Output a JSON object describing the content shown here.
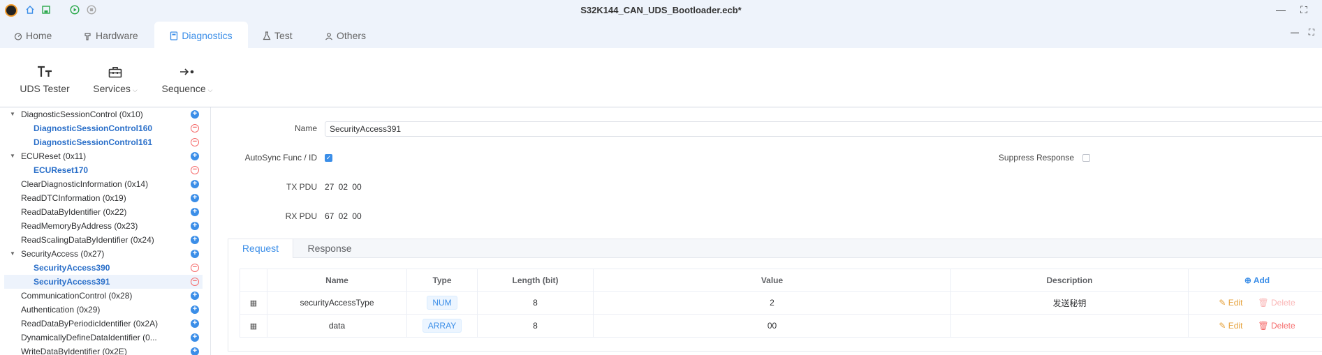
{
  "window": {
    "title": "S32K144_CAN_UDS_Bootloader.ecb*",
    "minimize": "—",
    "maximize": "⛶"
  },
  "menu_tabs": [
    {
      "label": "Home",
      "icon": "home-icon"
    },
    {
      "label": "Hardware",
      "icon": "hammer-icon"
    },
    {
      "label": "Diagnostics",
      "icon": "diagnostics-icon",
      "active": true
    },
    {
      "label": "Test",
      "icon": "flask-icon"
    },
    {
      "label": "Others",
      "icon": "person-icon"
    }
  ],
  "ribbon": {
    "uds_tester": "UDS Tester",
    "services": "Services",
    "sequence": "Sequence"
  },
  "tree": [
    {
      "label": "DiagnosticSessionControl (0x10)",
      "level": 0,
      "expanded": true,
      "btn": "add"
    },
    {
      "label": "DiagnosticSessionControl160",
      "level": 1,
      "btn": "remove"
    },
    {
      "label": "DiagnosticSessionControl161",
      "level": 1,
      "btn": "remove"
    },
    {
      "label": "ECUReset (0x11)",
      "level": 0,
      "expanded": true,
      "btn": "add"
    },
    {
      "label": "ECUReset170",
      "level": 1,
      "btn": "remove"
    },
    {
      "label": "ClearDiagnosticInformation (0x14)",
      "level": 0,
      "btn": "add"
    },
    {
      "label": "ReadDTCInformation (0x19)",
      "level": 0,
      "btn": "add"
    },
    {
      "label": "ReadDataByIdentifier (0x22)",
      "level": 0,
      "btn": "add"
    },
    {
      "label": "ReadMemoryByAddress (0x23)",
      "level": 0,
      "btn": "add"
    },
    {
      "label": "ReadScalingDataByIdentifier (0x24)",
      "level": 0,
      "btn": "add"
    },
    {
      "label": "SecurityAccess (0x27)",
      "level": 0,
      "expanded": true,
      "btn": "add"
    },
    {
      "label": "SecurityAccess390",
      "level": 1,
      "btn": "remove"
    },
    {
      "label": "SecurityAccess391",
      "level": 1,
      "btn": "remove",
      "selected": true
    },
    {
      "label": "CommunicationControl (0x28)",
      "level": 0,
      "btn": "add"
    },
    {
      "label": "Authentication (0x29)",
      "level": 0,
      "btn": "add"
    },
    {
      "label": "ReadDataByPeriodicIdentifier (0x2A)",
      "level": 0,
      "btn": "add"
    },
    {
      "label": "DynamicallyDefineDataIdentifier (0...",
      "level": 0,
      "btn": "add"
    },
    {
      "label": "WriteDataByIdentifier (0x2E)",
      "level": 0,
      "btn": "add"
    }
  ],
  "form": {
    "name_label": "Name",
    "name_value": "SecurityAccess391",
    "autosync_label": "AutoSync Func / ID",
    "autosync_checked": true,
    "suppress_label": "Suppress Response",
    "suppress_checked": false,
    "tx_label": "TX PDU",
    "tx_value": "27 02 00",
    "rx_label": "RX PDU",
    "rx_value": "67 02 00"
  },
  "panel": {
    "tabs": [
      "Request",
      "Response"
    ],
    "active_tab": "Request",
    "columns": [
      "Name",
      "Type",
      "Length (bit)",
      "Value",
      "Description"
    ],
    "add_label": "Add",
    "edit_label": "Edit",
    "delete_label": "Delete",
    "rows": [
      {
        "name": "securityAccessType",
        "type": "NUM",
        "length": "8",
        "value": "2",
        "description": "发送秘钥",
        "delete_disabled": true
      },
      {
        "name": "data",
        "type": "ARRAY",
        "length": "8",
        "value": "00",
        "description": "",
        "delete_disabled": false
      }
    ]
  },
  "colors": {
    "accent": "#3b8ee8",
    "danger": "#f56c6c",
    "warning": "#e6a23c",
    "chrome_bg": "#eef3fb"
  }
}
